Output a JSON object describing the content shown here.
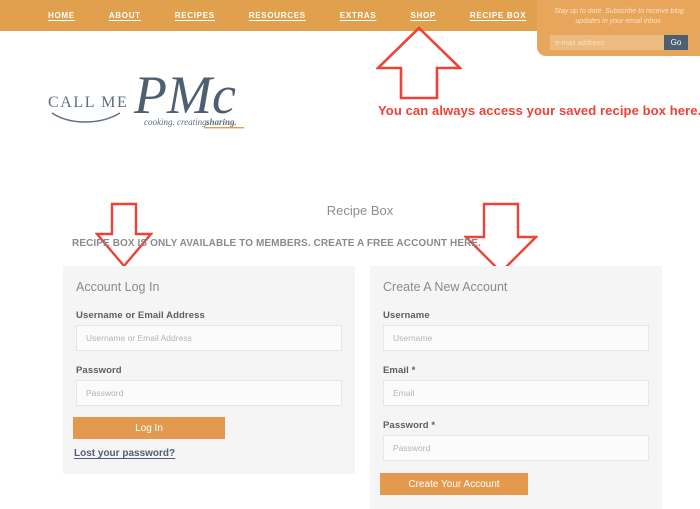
{
  "nav": {
    "items": [
      {
        "label": "HOME"
      },
      {
        "label": "ABOUT"
      },
      {
        "label": "RECIPES"
      },
      {
        "label": "RESOURCES"
      },
      {
        "label": "EXTRAS"
      },
      {
        "label": "SHOP"
      },
      {
        "label": "RECIPE BOX"
      }
    ]
  },
  "subscribe": {
    "blurb": "Stay up to date. Subscribe to receive blog updates in your email inbox.",
    "placeholder": "e-mail address",
    "value": "",
    "go_label": "Go"
  },
  "logo": {
    "line1": "CALL ME",
    "script": "PMc",
    "tagline": "cooking. creating. sharing."
  },
  "annotations": {
    "caption": "You can always access your saved recipe box here.",
    "color": "#ef4136",
    "arrows": [
      {
        "name": "recipe-box-nav-arrow",
        "direction": "up"
      },
      {
        "name": "login-panel-arrow",
        "direction": "down"
      },
      {
        "name": "signup-panel-arrow",
        "direction": "down"
      }
    ]
  },
  "main": {
    "title": "Recipe Box",
    "notice": "RECIPE BOX IS ONLY AVAILABLE TO MEMBERS. CREATE A FREE ACCOUNT HERE."
  },
  "login": {
    "title": "Account Log In",
    "fields": [
      {
        "label": "Username or Email Address",
        "placeholder": "Username or Email Address",
        "value": "",
        "type": "text"
      },
      {
        "label": "Password",
        "placeholder": "Password",
        "value": "",
        "type": "password"
      }
    ],
    "submit_label": "Log In",
    "lost_password_label": "Lost your password?"
  },
  "signup": {
    "title": "Create A New Account",
    "fields": [
      {
        "label": "Username",
        "placeholder": "Username",
        "value": "",
        "type": "text"
      },
      {
        "label": "Email *",
        "placeholder": "Email",
        "value": "",
        "type": "text"
      },
      {
        "label": "Password *",
        "placeholder": "Password",
        "value": "",
        "type": "password"
      }
    ],
    "submit_label": "Create Your Account"
  },
  "colors": {
    "nav_bar": "#e0a04e",
    "subscribe_panel": "#e8a65c",
    "button_orange": "#e39a4e",
    "go_button": "#4d5f70",
    "panel_bg": "#f5f5f5",
    "annotation_red": "#ef4136",
    "logo_slate": "#4d5f70"
  }
}
